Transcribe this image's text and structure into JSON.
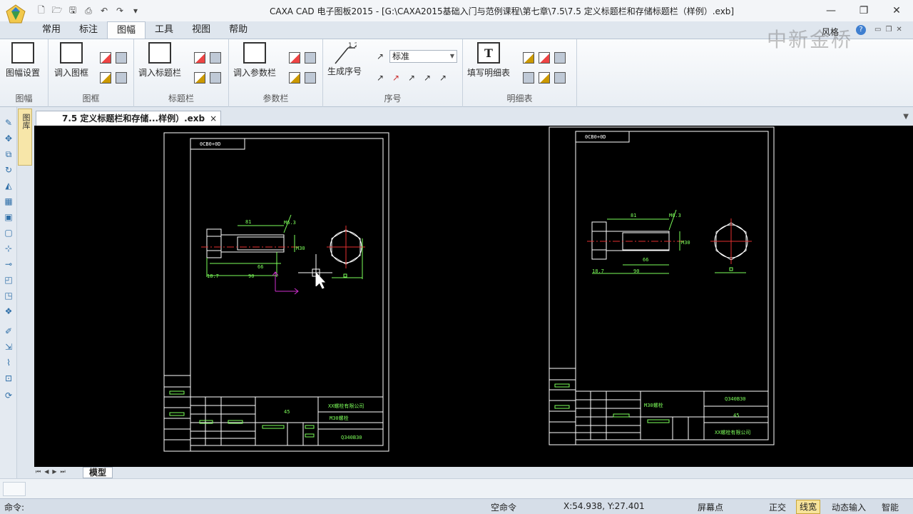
{
  "window": {
    "title": "CAXA CAD 电子图板2015 - [G:\\CAXA2015基础入门与范例课程\\第七章\\7.5\\7.5 定义标题栏和存储标题栏（样例）.exb]",
    "min": "—",
    "restore": "❐",
    "close": "✕"
  },
  "ribbon": {
    "tabs": [
      "常用",
      "标注",
      "图幅",
      "工具",
      "视图",
      "帮助"
    ],
    "active_tab": "图幅",
    "style_label": "风格",
    "help": "?",
    "groups": {
      "frame": {
        "label": "图幅",
        "settings": "图幅设置"
      },
      "border": {
        "label": "图框",
        "load": "调入图框"
      },
      "titleblock": {
        "label": "标题栏",
        "load": "调入标题栏"
      },
      "params": {
        "label": "参数栏",
        "load": "调入参数栏"
      },
      "balloon": {
        "label": "序号",
        "generate": "生成序号",
        "style": "标准"
      },
      "bom": {
        "label": "明细表",
        "fill": "填写明细表"
      }
    }
  },
  "left_panel": {
    "tab": "图库"
  },
  "document": {
    "tab_label": "7.5 定义标题栏和存储...样例）.exb",
    "close": "×"
  },
  "drawing": {
    "left": {
      "code_tag": "0CB0+0D",
      "dims": {
        "length81": "81",
        "d11": "M6.3",
        "len66": "66",
        "h18": "18.7",
        "len90": "90",
        "dia": "M30"
      },
      "title": {
        "company": "XX螺栓有限公司",
        "part": "M30螺栓",
        "material": "45",
        "code": "Q340B30"
      }
    },
    "right": {
      "code_tag": "0CB0+0D",
      "dims": {
        "length81": "81",
        "d11": "M6.3",
        "len66": "66",
        "h18": "18.7",
        "len90": "90",
        "dia": "M30"
      },
      "title": {
        "company": "XX螺栓有限公司",
        "part": "M30螺栓",
        "material": "45",
        "code": "Q340B30"
      }
    }
  },
  "sheet": {
    "model_tab": "模型"
  },
  "command": {
    "prompt": "命令:"
  },
  "status": {
    "command": "空命令",
    "coords": "X:54.938, Y:27.401",
    "snap": "屏幕点",
    "ortho": "正交",
    "linewidth": "线宽",
    "dynamic_input": "动态输入",
    "smart": "智能"
  },
  "watermark": "中新金桥"
}
